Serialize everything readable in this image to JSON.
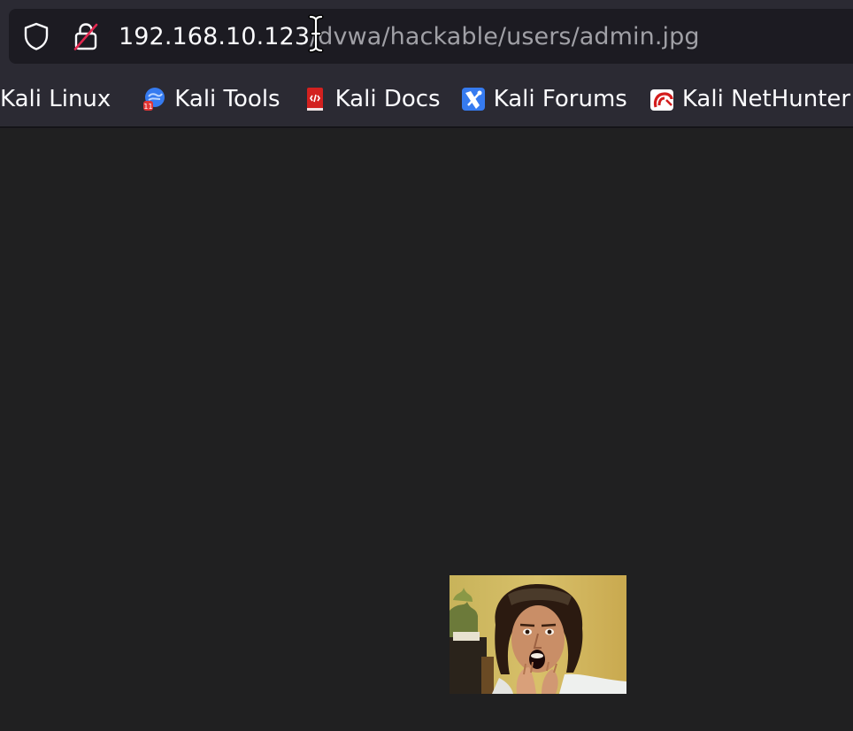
{
  "urlbar": {
    "host": "192.168.10.123",
    "path": "/dvwa/hackable/users/admin.jpg",
    "shield_icon": "shield-icon",
    "lock_icon": "insecure-lock-icon"
  },
  "bookmarks": [
    {
      "label": "Kali Linux",
      "icon": "kali-linux-icon"
    },
    {
      "label": "Kali Tools",
      "icon": "kali-tools-icon"
    },
    {
      "label": "Kali Docs",
      "icon": "kali-docs-icon"
    },
    {
      "label": "Kali Forums",
      "icon": "kali-forums-icon"
    },
    {
      "label": "Kali NetHunter",
      "icon": "kali-nethunter-icon"
    }
  ],
  "viewport": {
    "background": "#202021",
    "image": "admin-photo"
  },
  "colors": {
    "toolbar": "#2b2a33",
    "urlbar": "#1c1b22",
    "text": "#fbfbfe",
    "url_path": "#a0a0a6"
  }
}
